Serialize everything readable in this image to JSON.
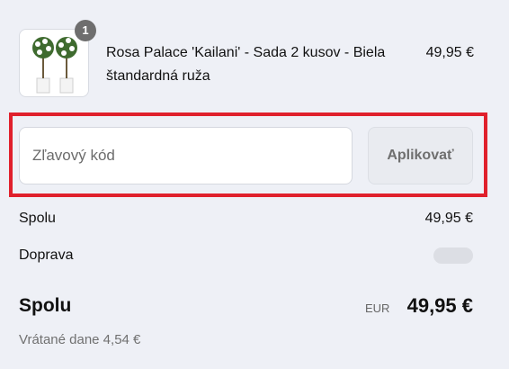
{
  "product": {
    "quantity_badge": "1",
    "title": "Rosa Palace 'Kailani' - Sada 2 kusov - Biela štandardná ruža",
    "price": "49,95 €"
  },
  "discount": {
    "placeholder": "Zľavový kód",
    "apply_label": "Aplikovať"
  },
  "summary": {
    "subtotal_label": "Spolu",
    "subtotal_value": "49,95 €",
    "shipping_label": "Doprava",
    "total_label": "Spolu",
    "currency": "EUR",
    "total_value": "49,95 €",
    "tax_note": "Vrátané dane 4,54 €"
  },
  "colors": {
    "highlight_outline": "#e0202c",
    "page_background": "#eef0f6"
  }
}
